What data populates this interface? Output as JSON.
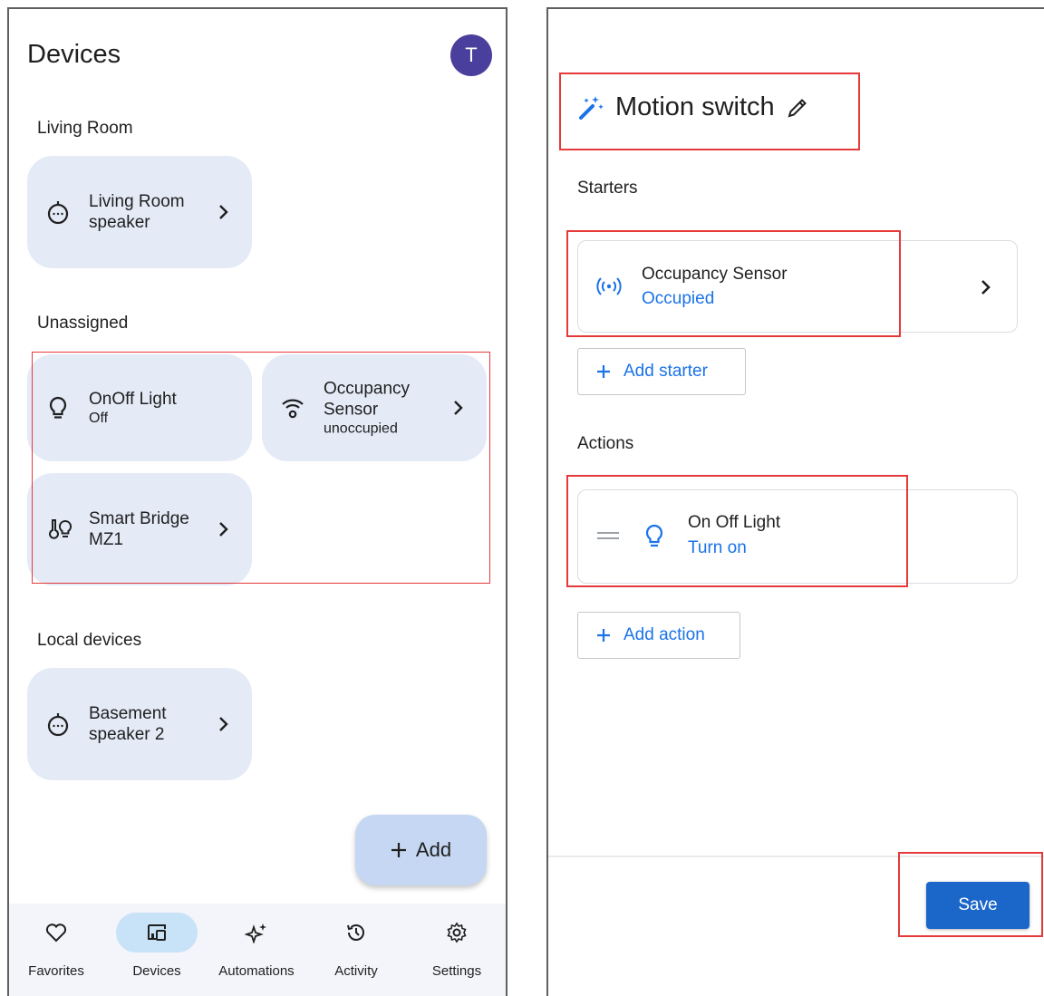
{
  "devices_screen": {
    "title": "Devices",
    "avatar_initial": "T",
    "sections": {
      "living_room": {
        "label": "Living Room",
        "tiles": [
          {
            "name_line1": "Living Room",
            "name_line2": "speaker",
            "icon": "speaker-icon"
          }
        ]
      },
      "unassigned": {
        "label": "Unassigned",
        "tiles": [
          {
            "name_line1": "OnOff Light",
            "status": "Off",
            "icon": "lightbulb-icon"
          },
          {
            "name_line1": "Occupancy",
            "name_line2": "Sensor",
            "status": "unoccupied",
            "icon": "sensor-signal-icon"
          },
          {
            "name_line1": "Smart Bridge",
            "name_line2": "MZ1",
            "icon": "bridge-icon"
          }
        ]
      },
      "local_devices": {
        "label": "Local devices",
        "tiles": [
          {
            "name_line1": "Basement",
            "name_line2": "speaker 2",
            "icon": "speaker-icon"
          }
        ]
      }
    },
    "fab": {
      "label": "Add",
      "icon": "plus-icon"
    },
    "nav": [
      {
        "label": "Favorites",
        "icon": "heart-icon",
        "active": false
      },
      {
        "label": "Devices",
        "icon": "devices-icon",
        "active": true
      },
      {
        "label": "Automations",
        "icon": "sparkle-icon",
        "active": false
      },
      {
        "label": "Activity",
        "icon": "history-icon",
        "active": false
      },
      {
        "label": "Settings",
        "icon": "gear-icon",
        "active": false
      }
    ]
  },
  "automation_screen": {
    "title": "Motion switch",
    "title_icon": "magic-wand-icon",
    "edit_icon": "pencil-icon",
    "starters": {
      "label": "Starters",
      "item": {
        "name": "Occupancy Sensor",
        "state": "Occupied",
        "icon": "broadcast-icon"
      },
      "add_label": "Add starter"
    },
    "actions": {
      "label": "Actions",
      "item": {
        "name": "On Off Light",
        "state": "Turn on",
        "icon": "lightbulb-icon"
      },
      "add_label": "Add action"
    },
    "save_label": "Save"
  },
  "colors": {
    "tile_bg": "#e4ebf7",
    "accent_blue": "#1a73e8",
    "save_button": "#1b66c9",
    "avatar": "#4a3f9c",
    "highlight_red": "#e5393a",
    "active_nav": "#c8e2f8"
  }
}
